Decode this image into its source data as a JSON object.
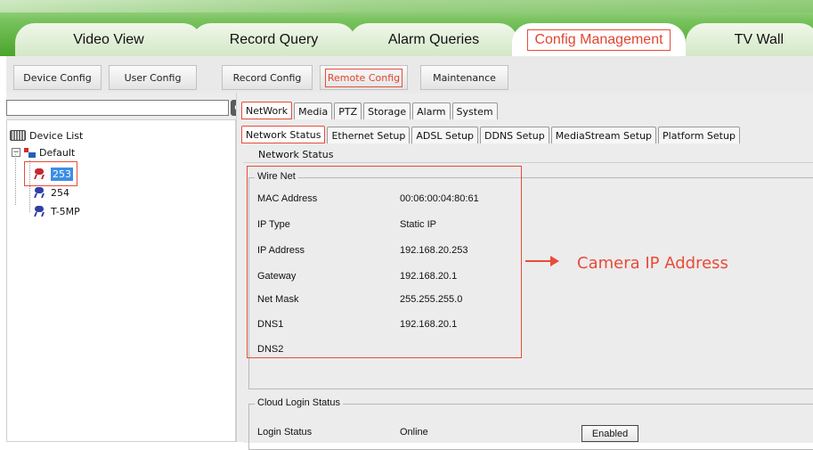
{
  "top_tabs": [
    {
      "label": "Video View"
    },
    {
      "label": "Record Query"
    },
    {
      "label": "Alarm Queries"
    },
    {
      "label": "Config Management"
    },
    {
      "label": "TV Wall"
    }
  ],
  "sub_buttons": [
    {
      "label": "Device Config"
    },
    {
      "label": "User Config"
    },
    {
      "label": "Record Config"
    },
    {
      "label": "Remote Config"
    },
    {
      "label": "Maintenance"
    }
  ],
  "search": {
    "value": "",
    "placeholder": ""
  },
  "tree": {
    "root": "Device List",
    "group": "Default",
    "devices": [
      "253",
      "254",
      "T-5MP"
    ]
  },
  "config_tabs": [
    "NetWork",
    "Media",
    "PTZ",
    "Storage",
    "Alarm",
    "System"
  ],
  "network_tabs": [
    "Network Status",
    "Ethernet Setup",
    "ADSL Setup",
    "DDNS Setup",
    "MediaStream Setup",
    "Platform Setup"
  ],
  "caption": "Network Status",
  "wire_net": {
    "title": "Wire Net",
    "fields": [
      {
        "label": "MAC Address",
        "value": "00:06:00:04:80:61"
      },
      {
        "label": "IP Type",
        "value": "Static IP"
      },
      {
        "label": "IP Address",
        "value": "192.168.20.253"
      },
      {
        "label": "Gateway",
        "value": "192.168.20.1"
      },
      {
        "label": "Net Mask",
        "value": "255.255.255.0"
      },
      {
        "label": "DNS1",
        "value": "192.168.20.1"
      },
      {
        "label": "DNS2",
        "value": ""
      }
    ]
  },
  "annotation": "Camera IP Address",
  "cloud": {
    "title": "Cloud Login Status",
    "label": "Login Status",
    "value": "Online",
    "button": "Enabled"
  },
  "colors": {
    "accent_red": "#e84b3a",
    "tab_green": "#4aa52d",
    "selection_blue": "#3d8ee6"
  }
}
